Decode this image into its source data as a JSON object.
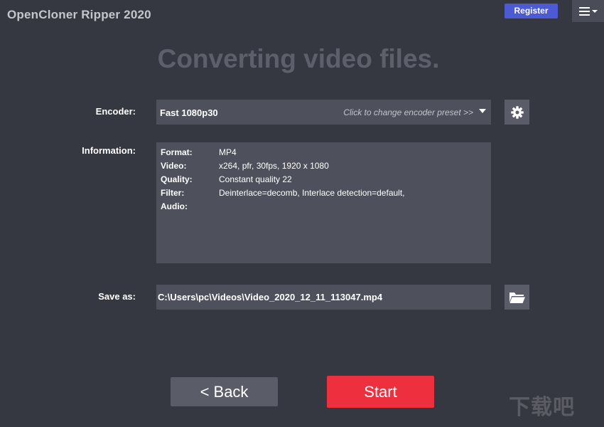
{
  "app": {
    "title": "OpenCloner Ripper 2020"
  },
  "header": {
    "register_label": "Register",
    "menu_icon": "hamburger-menu-icon"
  },
  "page": {
    "heading": "Converting video files."
  },
  "encoder": {
    "label": "Encoder:",
    "value": "Fast 1080p30",
    "hint": "Click to change encoder preset >>",
    "settings_icon": "gear-icon"
  },
  "information": {
    "label": "Information:",
    "rows": [
      {
        "key": "Format:",
        "value": "MP4"
      },
      {
        "key": "Video:",
        "value": "x264, pfr, 30fps, 1920 x 1080"
      },
      {
        "key": "Quality:",
        "value": "Constant quality 22"
      },
      {
        "key": "Filter:",
        "value": "Deinterlace=decomb, Interlace detection=default,"
      },
      {
        "key": "Audio:",
        "value": ""
      }
    ]
  },
  "save_as": {
    "label": "Save as:",
    "value": "C:\\Users\\pc\\Videos\\Video_2020_12_11_113047.mp4",
    "browse_icon": "folder-open-icon"
  },
  "footer": {
    "back_label": "<  Back",
    "start_label": "Start"
  },
  "watermark": {
    "text": "下载吧"
  },
  "colors": {
    "background": "#363841",
    "panel": "#4e515b",
    "heading": "#5d606a",
    "register": "#4c5ad4",
    "start": "#ee2f3e",
    "button": "#5a5d67"
  }
}
